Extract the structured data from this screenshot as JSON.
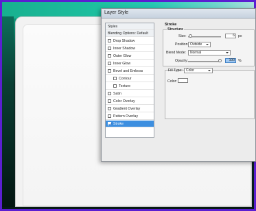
{
  "dialog": {
    "title": "Layer Style"
  },
  "styles_list": {
    "items": [
      {
        "label": "Styles",
        "type": "header"
      },
      {
        "label": "Blending Options: Default",
        "type": "header"
      },
      {
        "label": "Drop Shadow",
        "checked": false
      },
      {
        "label": "Inner Shadow",
        "checked": false
      },
      {
        "label": "Outer Glow",
        "checked": false
      },
      {
        "label": "Inner Glow",
        "checked": false
      },
      {
        "label": "Bevel and Emboss",
        "checked": false
      },
      {
        "label": "Contour",
        "checked": false,
        "sub": true
      },
      {
        "label": "Texture",
        "checked": false,
        "sub": true
      },
      {
        "label": "Satin",
        "checked": false
      },
      {
        "label": "Color Overlay",
        "checked": false
      },
      {
        "label": "Gradient Overlay",
        "checked": false
      },
      {
        "label": "Pattern Overlay",
        "checked": false
      },
      {
        "label": "Stroke",
        "checked": true,
        "selected": true
      }
    ]
  },
  "stroke": {
    "heading": "Stroke",
    "structure_label": "Structure",
    "size_label": "Size:",
    "size_value": "6",
    "size_unit": "px",
    "size_level": 0.05,
    "position_label": "Position:",
    "position_value": "Outside",
    "blend_label": "Blend Mode:",
    "blend_value": "Normal",
    "opacity_label": "Opacity:",
    "opacity_value": "100",
    "opacity_unit": "%",
    "opacity_level": 1.0,
    "fill_type_label": "Fill Type:",
    "fill_type_value": "Color",
    "color_label": "Color:",
    "color_value": "#ffffff"
  },
  "colors": {
    "border": "#5b1fd1",
    "accent_teal": "#1ec0a0",
    "selection_blue": "#3d8fe0"
  }
}
